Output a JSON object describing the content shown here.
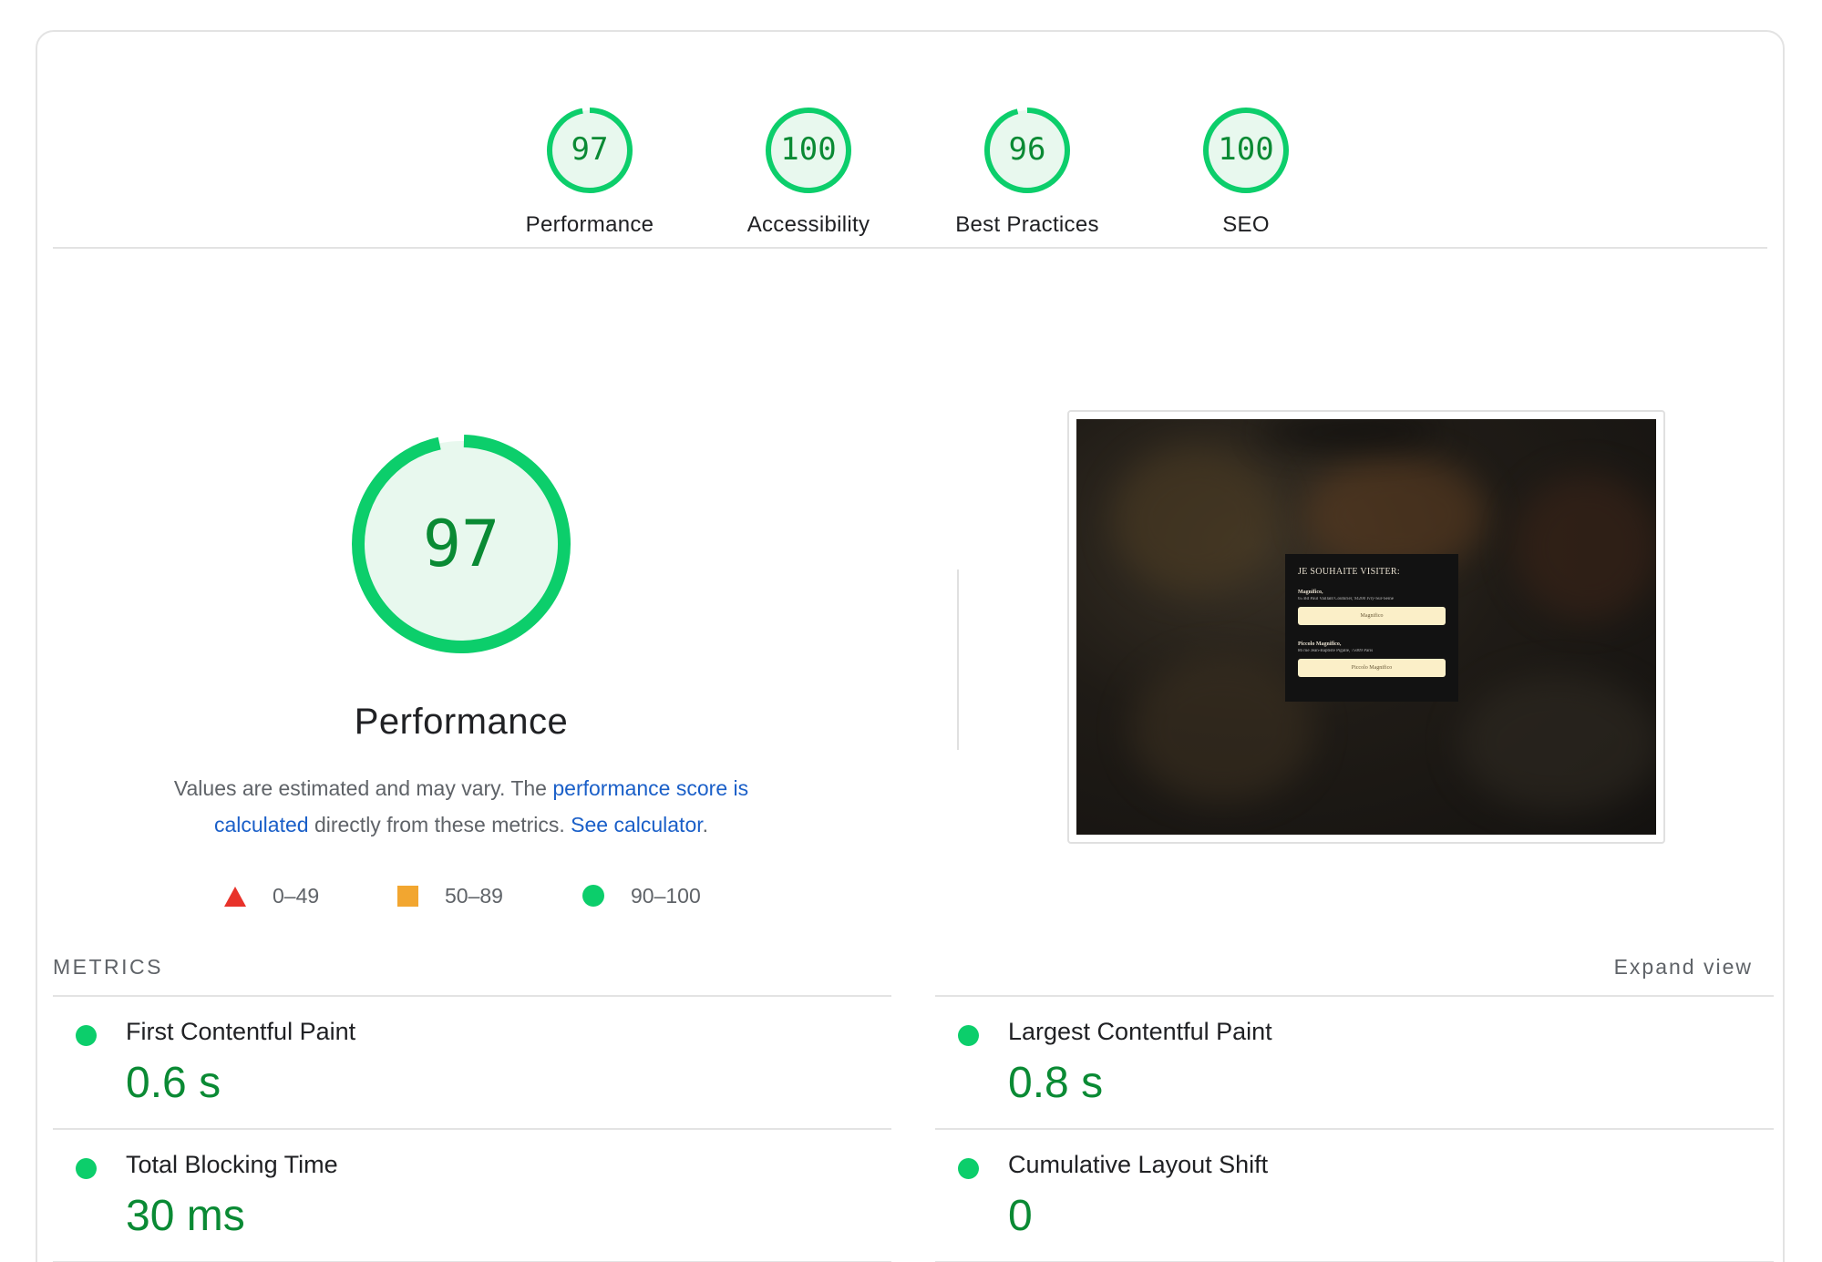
{
  "categories": [
    {
      "score": "97",
      "label": "Performance",
      "fraction": 0.97
    },
    {
      "score": "100",
      "label": "Accessibility",
      "fraction": 1.0
    },
    {
      "score": "96",
      "label": "Best Practices",
      "fraction": 0.96
    },
    {
      "score": "100",
      "label": "SEO",
      "fraction": 1.0
    }
  ],
  "performance": {
    "score": "97",
    "fraction": 0.97,
    "title": "Performance",
    "desc_prefix": "Values are estimated and may vary. The ",
    "desc_link1": "performance score is calculated",
    "desc_middle": " directly from these metrics. ",
    "desc_link2": "See calculator",
    "desc_suffix": "."
  },
  "legend": [
    {
      "shape": "triangle",
      "range": "0–49",
      "color": "#e8322a"
    },
    {
      "shape": "square",
      "range": "50–89",
      "color": "#f2a630"
    },
    {
      "shape": "circle",
      "range": "90–100",
      "color": "#0cce6b"
    }
  ],
  "screenshot": {
    "modal_title": "JE SOUHAITE VISITER:",
    "locations": [
      {
        "name": "Magnifico,",
        "address": "65 Bd Paul Vaillant Couturier, 94200 Ivry-Sur-Seine",
        "button": "Magnifico"
      },
      {
        "name": "Piccolo Magnifico,",
        "address": "86 rue Jean-Baptiste Pigalle, 75009 Paris",
        "button": "Piccolo Magnifico"
      }
    ]
  },
  "metrics": {
    "heading": "METRICS",
    "expand_label": "Expand view",
    "items": [
      {
        "label": "First Contentful Paint",
        "value": "0.6 s"
      },
      {
        "label": "Largest Contentful Paint",
        "value": "0.8 s"
      },
      {
        "label": "Total Blocking Time",
        "value": "30 ms"
      },
      {
        "label": "Cumulative Layout Shift",
        "value": "0"
      }
    ]
  },
  "colors": {
    "pass": "#0cce6b",
    "pass_text": "#0a8a34",
    "pass_fill": "#e8f8ee",
    "link": "#1a5fc8"
  }
}
